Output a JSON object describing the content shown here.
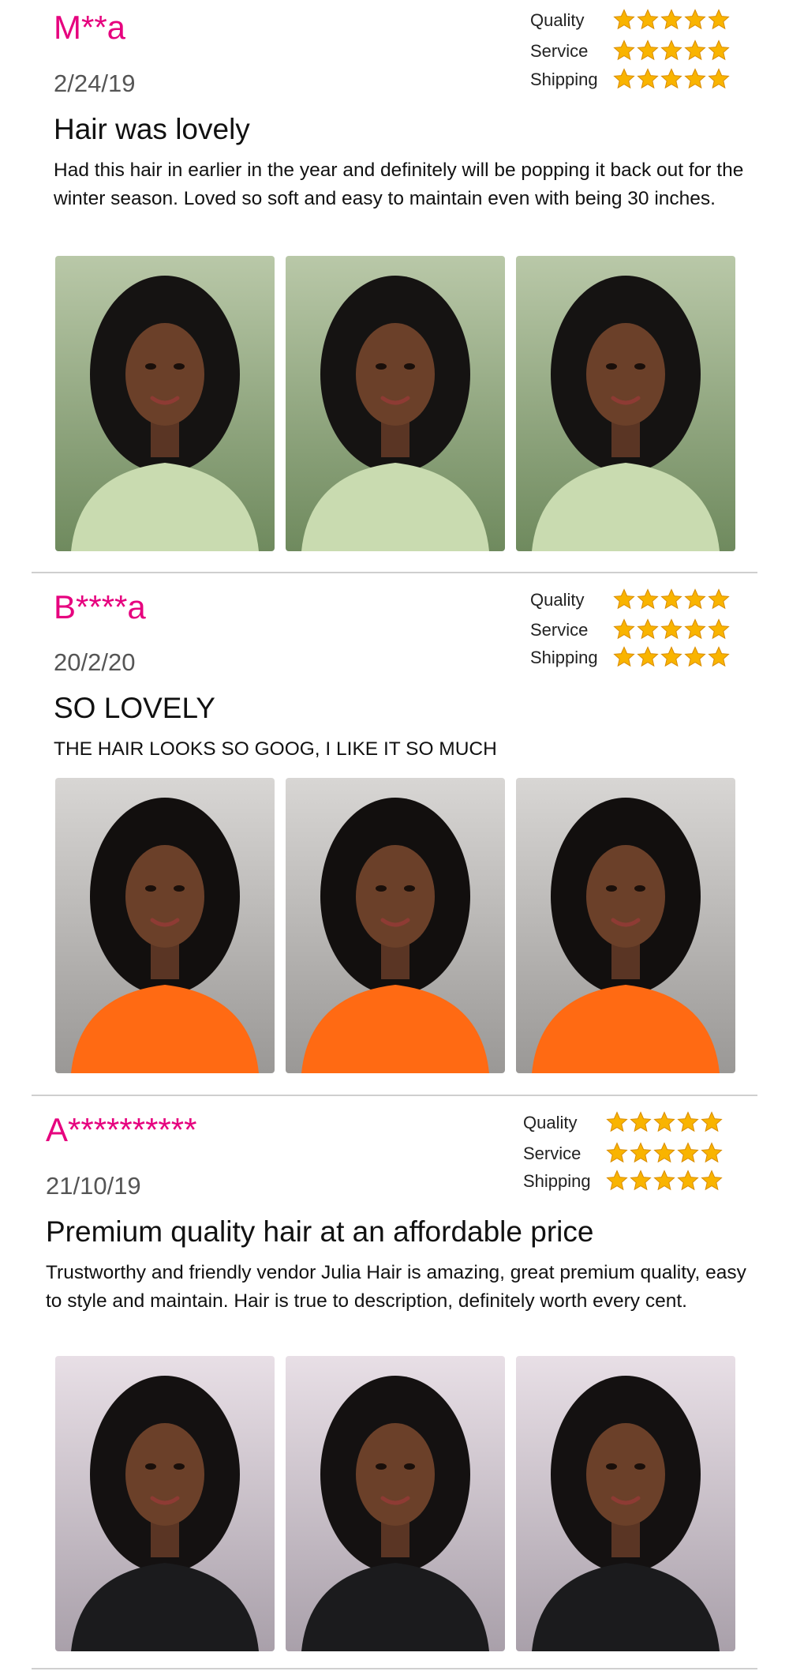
{
  "rating_labels": {
    "quality": "Quality",
    "service": "Service",
    "shipping": "Shipping"
  },
  "colors": {
    "reviewer": "#e6007e",
    "star": "#f9b400",
    "divider": "#cfcfcf"
  },
  "reviews": [
    {
      "reviewer": "M**a",
      "date": "2/24/19",
      "title": "Hair was lovely",
      "body": "Had this hair in earlier in the year and definitely will be popping it back out for the winter season. Loved so soft and easy to maintain even with being 30 inches.",
      "ratings": {
        "quality": 5,
        "service": 5,
        "shipping": 5
      },
      "photos": [
        "customer photo 1",
        "customer photo 2",
        "customer photo 3"
      ]
    },
    {
      "reviewer": "B****a",
      "date": "20/2/20",
      "title": "SO LOVELY",
      "body": "THE HAIR LOOKS SO GOOG, I LIKE IT SO MUCH",
      "ratings": {
        "quality": 5,
        "service": 5,
        "shipping": 5
      },
      "photos": [
        "customer photo 1",
        "customer photo 2",
        "customer photo 3"
      ]
    },
    {
      "reviewer": "A**********",
      "date": "21/10/19",
      "title": "Premium quality hair at an affordable price",
      "body": "Trustworthy and friendly vendor Julia Hair is amazing, great premium quality, easy to style and maintain. Hair is true to description, definitely worth every cent.",
      "ratings": {
        "quality": 5,
        "service": 5,
        "shipping": 5
      },
      "photos": [
        "customer photo 1",
        "customer photo 2",
        "customer photo 3"
      ]
    }
  ]
}
